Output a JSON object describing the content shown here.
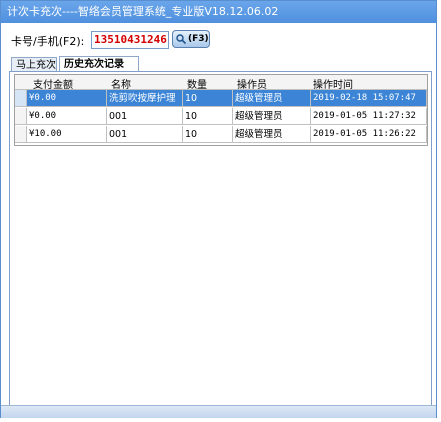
{
  "window": {
    "title": "计次卡充次----智络会员管理系统_专业版V18.12.06.02"
  },
  "card": {
    "label": "卡号/手机(F2):",
    "value": "13510431246",
    "search_label": "(F3)"
  },
  "tabs": [
    {
      "label": "马上充次",
      "active": false
    },
    {
      "label": "历史充次记录",
      "active": true
    }
  ],
  "table": {
    "headers": [
      "支付金额",
      "名称",
      "数量",
      "操作员",
      "操作时间"
    ],
    "rows": [
      {
        "amount": "¥0.00",
        "name": "洗剪吹按摩护理",
        "qty": "10",
        "operator": "超级管理员",
        "time": "2019-02-18 15:07:47",
        "selected": true
      },
      {
        "amount": "¥0.00",
        "name": "001",
        "qty": "10",
        "operator": "超级管理员",
        "time": "2019-01-05 11:27:32",
        "selected": false
      },
      {
        "amount": "¥10.00",
        "name": "001",
        "qty": "10",
        "operator": "超级管理员",
        "time": "2019-01-05 11:26:22",
        "selected": false
      }
    ]
  },
  "colors": {
    "titlebar": "#4f90de",
    "selection": "#3b84d6",
    "card_value": "#d40000"
  }
}
